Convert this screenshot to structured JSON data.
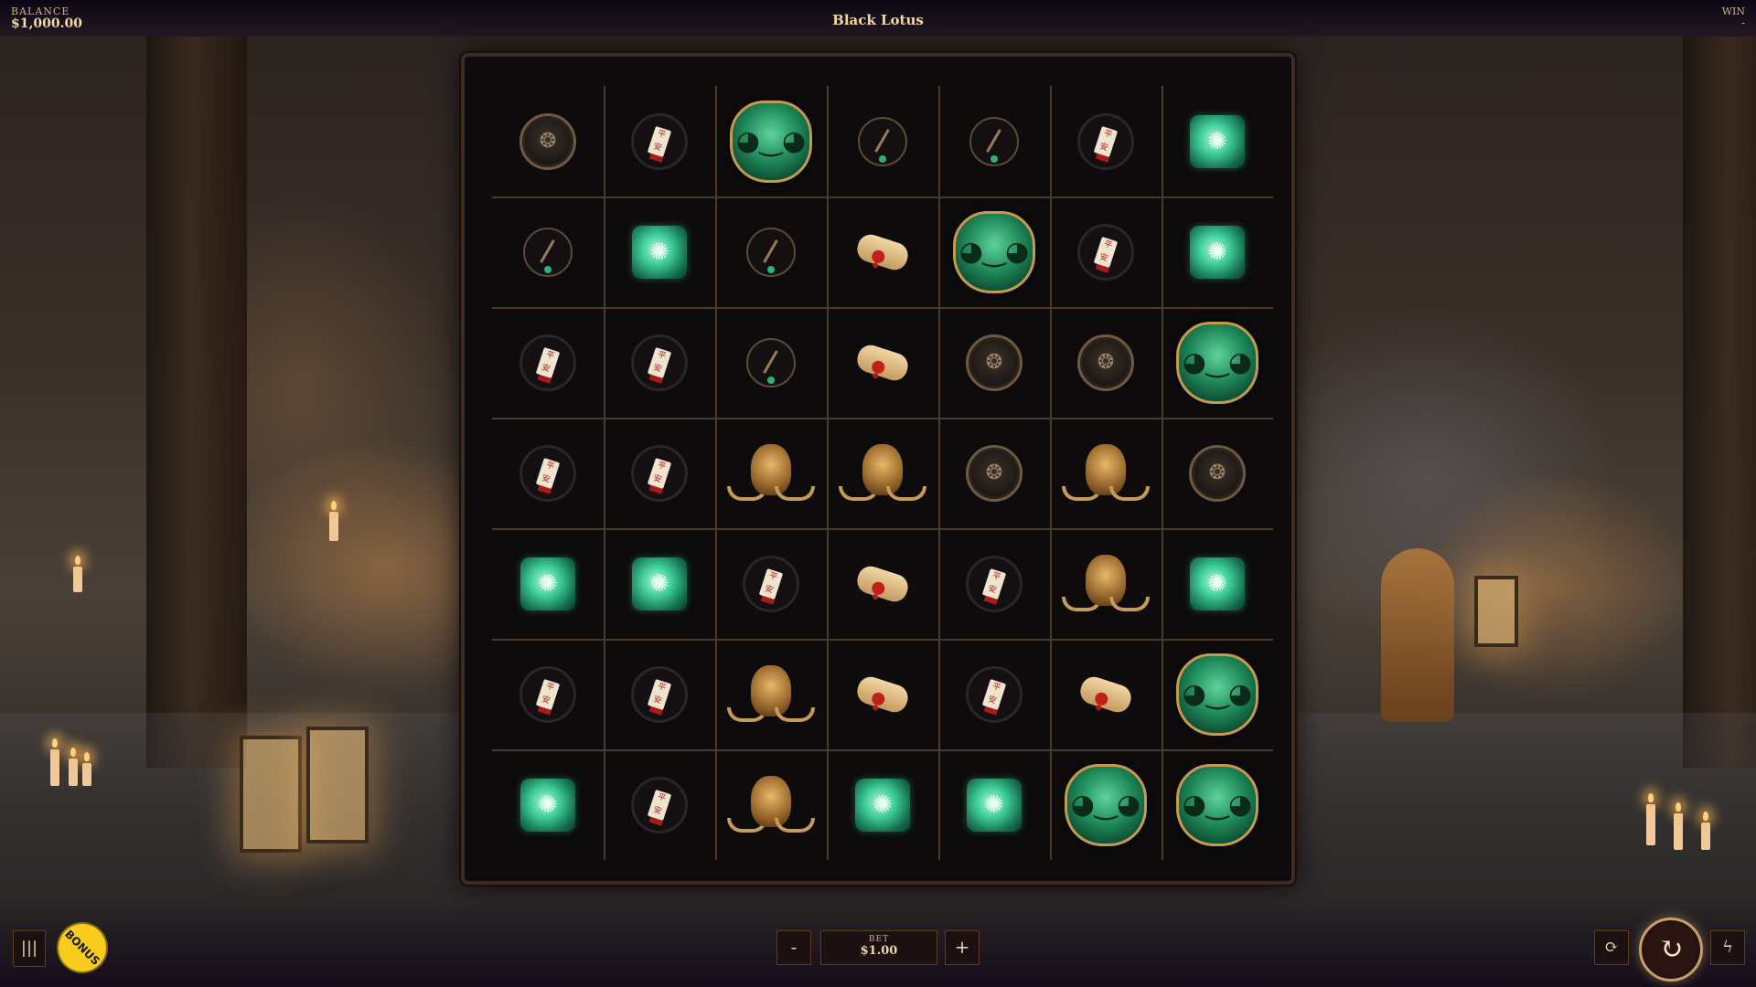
{
  "header": {
    "balance_label": "BALANCE",
    "balance_value": "$1,000.00",
    "title": "Black Lotus",
    "win_label": "WIN",
    "win_value": "-"
  },
  "board": {
    "rows": [
      [
        "coin",
        "tag",
        "mask-green",
        "sticks",
        "sticks",
        "tag",
        "jade"
      ],
      [
        "sticks",
        "jade",
        "sticks",
        "scroll",
        "mask-green",
        "tag",
        "jade"
      ],
      [
        "tag",
        "tag",
        "sticks",
        "scroll",
        "coin",
        "coin",
        "mask-green"
      ],
      [
        "tag",
        "tag",
        "mask-gold",
        "mask-gold",
        "coin",
        "mask-gold",
        "coin"
      ],
      [
        "jade",
        "jade",
        "tag",
        "scroll",
        "tag",
        "mask-gold",
        "jade"
      ],
      [
        "tag",
        "tag",
        "mask-gold",
        "scroll",
        "tag",
        "scroll",
        "mask-green"
      ],
      [
        "jade",
        "tag",
        "mask-gold",
        "jade",
        "jade",
        "mask-green",
        "mask-green"
      ]
    ]
  },
  "controls": {
    "menu_icon": "menu-icon",
    "bonus_label": "BONUS",
    "minus_label": "-",
    "plus_label": "+",
    "bet_label": "BET",
    "bet_value": "$1.00",
    "autoplay_icon": "autoplay-icon",
    "spin_icon": "spin-icon",
    "turbo_icon": "turbo-icon"
  },
  "colors": {
    "accent_gold": "#c9a063",
    "bonus_yellow": "#f7cc1d",
    "jade_green": "#3fcf9b"
  }
}
